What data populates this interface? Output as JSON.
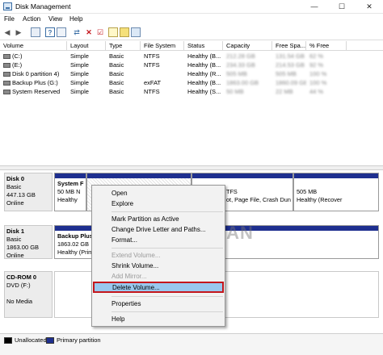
{
  "window": {
    "title": "Disk Management",
    "controls": [
      "—",
      "☐",
      "✕"
    ]
  },
  "menu": [
    "File",
    "Action",
    "View",
    "Help"
  ],
  "toolbar": [
    "back-arrow-icon",
    "forward-arrow-icon",
    "console-tree-icon",
    "help-icon",
    "properties-icon",
    "connect-icon",
    "delete-icon",
    "check-icon",
    "new-icon",
    "open-icon",
    "list-icon"
  ],
  "volume_table": {
    "headers": [
      "Volume",
      "Layout",
      "Type",
      "File System",
      "Status",
      "Capacity",
      "Free Spa...",
      "% Free"
    ],
    "rows": [
      {
        "volume": "(C:)",
        "layout": "Simple",
        "type": "Basic",
        "fs": "NTFS",
        "status": "Healthy (B...",
        "capacity": "212.28 GB",
        "free": "131.54 GB",
        "pct": "62 %"
      },
      {
        "volume": "(E:)",
        "layout": "Simple",
        "type": "Basic",
        "fs": "NTFS",
        "status": "Healthy (B...",
        "capacity": "234.33 GB",
        "free": "214.53 GB",
        "pct": "92 %"
      },
      {
        "volume": "Disk 0 partition 4)",
        "layout": "Simple",
        "type": "Basic",
        "fs": "",
        "status": "Healthy (R...",
        "capacity": "505 MB",
        "free": "505 MB",
        "pct": "100 %"
      },
      {
        "volume": "Backup Plus (G:)",
        "layout": "Simple",
        "type": "Basic",
        "fs": "exFAT",
        "status": "Healthy (B...",
        "capacity": "1863.00 GB",
        "free": "1860.09 GB",
        "pct": "100 %"
      },
      {
        "volume": "System Reserved",
        "layout": "Simple",
        "type": "Basic",
        "fs": "NTFS",
        "status": "Healthy (S...",
        "capacity": "50 MB",
        "free": "22 MB",
        "pct": "44 %"
      }
    ]
  },
  "disks": [
    {
      "name": "Disk 0",
      "type": "Basic",
      "size": "447.13 GB",
      "state": "Online",
      "partitions": [
        {
          "name": "System F",
          "line2": "50 MB N",
          "line3": "Healthy"
        },
        {
          "name": "",
          "line2": "",
          "line3": ""
        },
        {
          "name": "",
          "line2": "TFS",
          "line3": "ot, Page File, Crash Dun"
        },
        {
          "name": "",
          "line2": "505 MB",
          "line3": "Healthy (Recover"
        }
      ]
    },
    {
      "name": "Disk 1",
      "type": "Basic",
      "size": "1863.00 GB",
      "state": "Online",
      "partitions": [
        {
          "name": "Backup Plus",
          "line2": "1863.02 GB",
          "line3": "Healthy (Prim"
        }
      ]
    },
    {
      "name": "CD-ROM 0",
      "type": "DVD (F:)",
      "size": "",
      "state": "No Media",
      "partitions": []
    }
  ],
  "legend": [
    {
      "label": "Unallocated",
      "color": "#000000"
    },
    {
      "label": "Primary partition",
      "color": "#1e2f8f"
    }
  ],
  "context_menu": {
    "items": [
      {
        "label": "Open",
        "enabled": true
      },
      {
        "label": "Explore",
        "enabled": true
      },
      {
        "label": "Mark Partition as Active",
        "enabled": true
      },
      {
        "label": "Change Drive Letter and Paths...",
        "enabled": true
      },
      {
        "label": "Format...",
        "enabled": true
      },
      {
        "label": "Extend Volume...",
        "enabled": false
      },
      {
        "label": "Shrink Volume...",
        "enabled": true
      },
      {
        "label": "Add Mirror...",
        "enabled": false
      },
      {
        "label": "Delete Volume...",
        "enabled": true,
        "highlighted": true
      },
      {
        "label": "Properties",
        "enabled": true
      },
      {
        "label": "Help",
        "enabled": true
      }
    ]
  },
  "watermark": "MOBIGYAAN"
}
